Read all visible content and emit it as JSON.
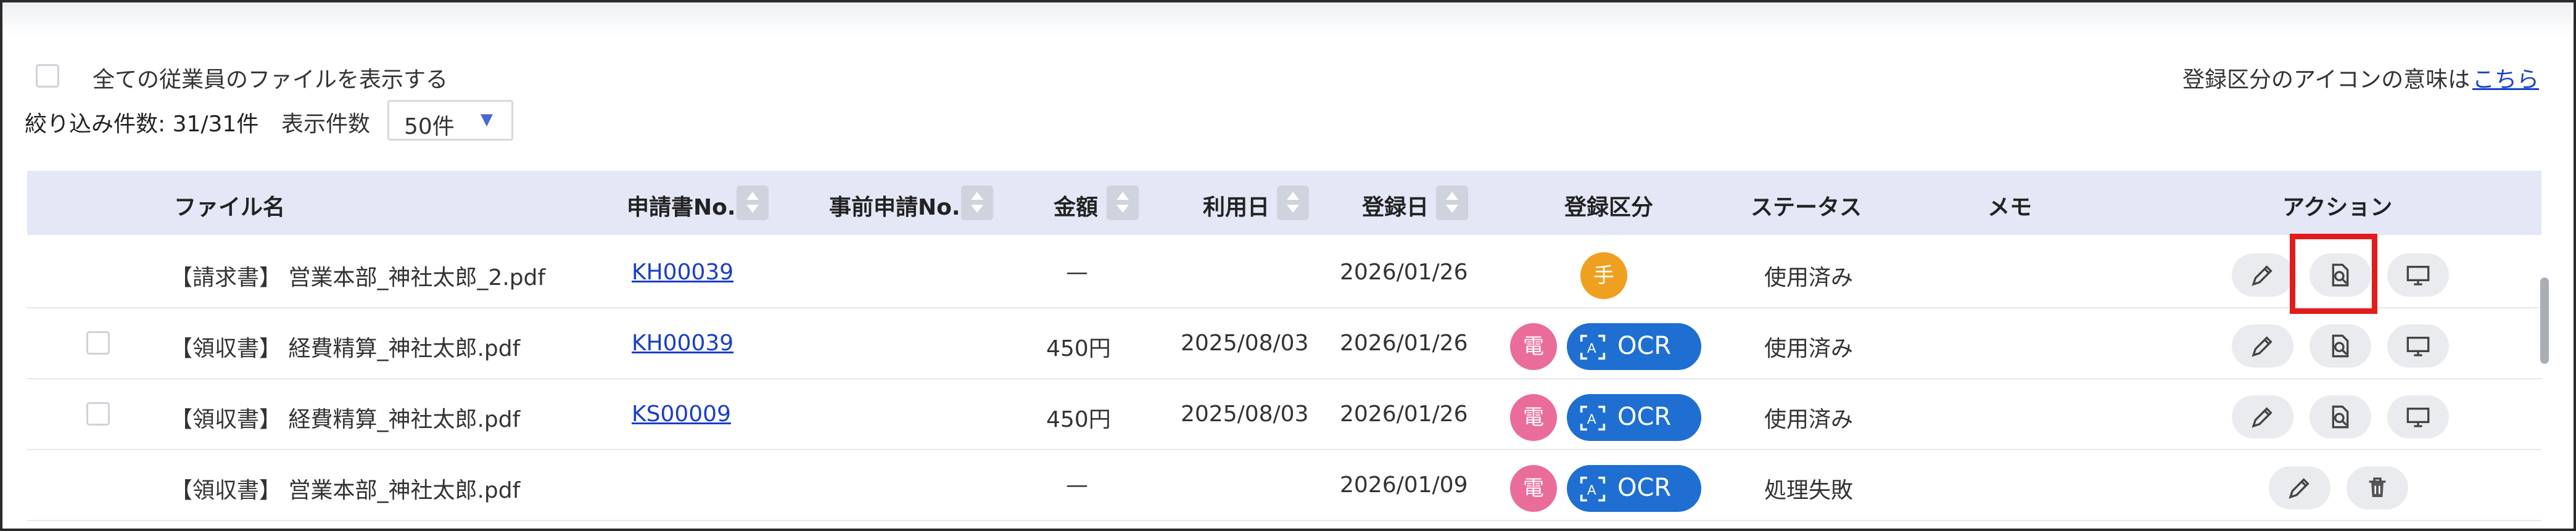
{
  "toolbar": {
    "show_all_label": "全ての従業員のファイルを表示する",
    "legend_note": "登録区分のアイコンの意味は",
    "legend_link": "こちら",
    "filter_count": "絞り込み件数: 31/31件",
    "per_page_label": "表示件数",
    "per_page_value": "50件"
  },
  "columns": {
    "filename": "ファイル名",
    "application_no": "申請書No.",
    "pre_application_no": "事前申請No.",
    "amount": "金額",
    "usage_date": "利用日",
    "registered_date": "登録日",
    "registration_type": "登録区分",
    "status": "ステータス",
    "memo": "メモ",
    "action": "アクション"
  },
  "rows": [
    {
      "filename": "【請求書】 営業本部_神社太郎_2.pdf",
      "application_no": "KH00039",
      "amount": "—",
      "usage_date": "",
      "registered_date": "2026/01/26",
      "type_badge": "手",
      "ocr": "",
      "status": "使用済み",
      "has_checkbox": false,
      "actions": [
        "pencil-icon",
        "file-search-icon",
        "monitor-icon"
      ]
    },
    {
      "filename": "【領収書】 経費精算_神社太郎.pdf",
      "application_no": "KH00039",
      "amount": "450円",
      "usage_date": "2025/08/03",
      "registered_date": "2026/01/26",
      "type_badge": "電",
      "ocr": "OCR",
      "status": "使用済み",
      "has_checkbox": true,
      "actions": [
        "pencil-icon",
        "file-search-icon",
        "monitor-icon"
      ]
    },
    {
      "filename": "【領収書】 経費精算_神社太郎.pdf",
      "application_no": "KS00009",
      "amount": "450円",
      "usage_date": "2025/08/03",
      "registered_date": "2026/01/26",
      "type_badge": "電",
      "ocr": "OCR",
      "status": "使用済み",
      "has_checkbox": true,
      "actions": [
        "pencil-icon",
        "file-search-icon",
        "monitor-icon"
      ]
    },
    {
      "filename": "【領収書】 営業本部_神社太郎.pdf",
      "application_no": "",
      "amount": "—",
      "usage_date": "",
      "registered_date": "2026/01/09",
      "type_badge": "電",
      "ocr": "OCR",
      "status": "処理失敗",
      "has_checkbox": false,
      "actions": [
        "pencil-icon",
        "trash-icon"
      ]
    }
  ],
  "colors": {
    "header_bg": "#e3e7f6",
    "hand_badge": "#f0a020",
    "electronic_badge": "#ea6c9a",
    "ocr_badge": "#1e6fd1",
    "link": "#1a3ec8",
    "highlight": "#e21c1c"
  }
}
